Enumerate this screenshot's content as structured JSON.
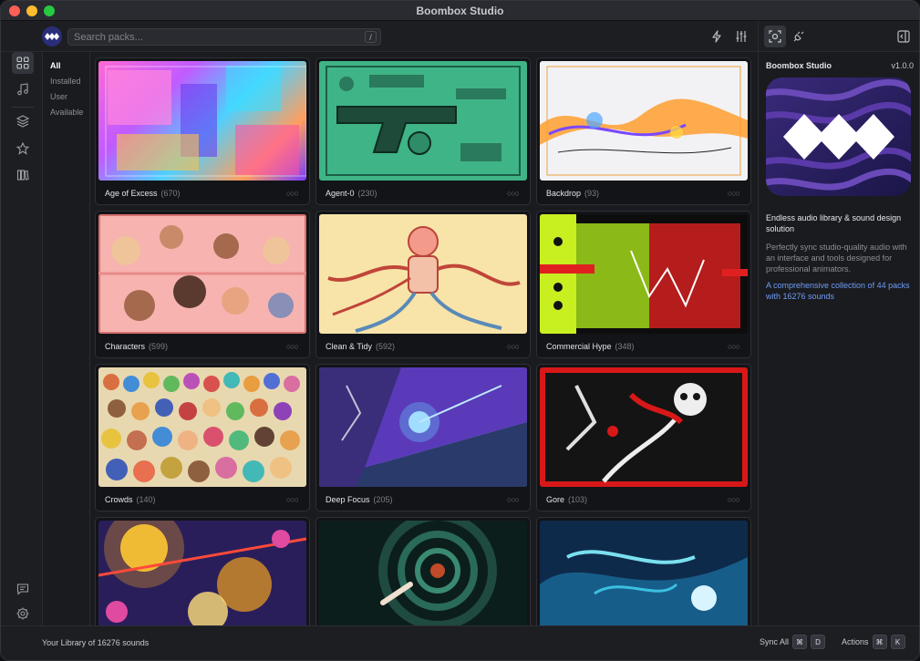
{
  "app": {
    "title": "Boombox Studio"
  },
  "search": {
    "placeholder": "Search packs...",
    "shortcut": "/"
  },
  "filters": [
    {
      "label": "All",
      "active": true
    },
    {
      "label": "Installed",
      "active": false
    },
    {
      "label": "User",
      "active": false
    },
    {
      "label": "Available",
      "active": false
    }
  ],
  "packs": [
    {
      "name": "Age of Excess",
      "count": "(670)",
      "theme": "neon-city"
    },
    {
      "name": "Agent-0",
      "count": "(230)",
      "theme": "green-gadgets"
    },
    {
      "name": "Backdrop",
      "count": "(93)",
      "theme": "white-ribbon"
    },
    {
      "name": "Characters",
      "count": "(599)",
      "theme": "pink-portraits"
    },
    {
      "name": "Clean & Tidy",
      "count": "(592)",
      "theme": "cream-robot"
    },
    {
      "name": "Commercial Hype",
      "count": "(348)",
      "theme": "lime-dancers"
    },
    {
      "name": "Crowds",
      "count": "(140)",
      "theme": "crowd-mosaic"
    },
    {
      "name": "Deep Focus",
      "count": "(205)",
      "theme": "blue-purple-comic"
    },
    {
      "name": "Gore",
      "count": "(103)",
      "theme": "red-skeleton"
    },
    {
      "name": "",
      "count": "",
      "theme": "gold-explosion"
    },
    {
      "name": "",
      "count": "",
      "theme": "teal-vortex"
    },
    {
      "name": "",
      "count": "",
      "theme": "blue-splash"
    }
  ],
  "more_glyph": "○○○",
  "panel": {
    "app_name": "Boombox Studio",
    "version": "v1.0.0",
    "heading": "Endless audio library & sound design solution",
    "description": "Perfectly sync studio-quality audio with an interface and tools designed for professional animators.",
    "link": "A comprehensive collection of 44 packs with 16276 sounds"
  },
  "status": {
    "library": "Your Library of 16276 sounds",
    "sync_label": "Sync All",
    "sync_keys": [
      "⌘",
      "D"
    ],
    "actions_label": "Actions",
    "actions_keys": [
      "⌘",
      "K"
    ]
  },
  "icons": {
    "rail": [
      "grid-icon",
      "music-note-icon",
      "layers-icon",
      "star-icon",
      "library-icon",
      "chat-icon",
      "settings-icon"
    ],
    "toolbar": [
      "bolt-icon",
      "sliders-icon",
      "scan-icon",
      "plugin-icon",
      "sidebar-toggle-icon"
    ]
  },
  "colors": {
    "accent_link": "#6f9cf4",
    "background": "#1d1e22",
    "logo_bg": "#2a2d78"
  }
}
